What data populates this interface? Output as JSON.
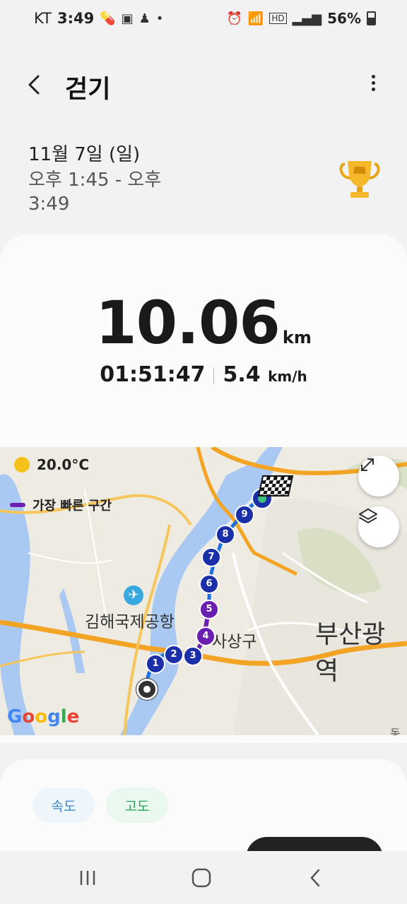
{
  "status_bar": {
    "carrier": "KT",
    "time": "3:49",
    "battery": "56%",
    "left_icons": [
      "pill-icon",
      "image-icon",
      "person-icon",
      "dot-icon"
    ],
    "right_icons": [
      "alarm-icon",
      "wifi-icon",
      "hd-icon",
      "signal-icon",
      "battery-icon"
    ]
  },
  "header": {
    "title": "걷기"
  },
  "summary": {
    "date": "11월 7일 (일)",
    "time_range": "오후 1:45 - 오후 3:49"
  },
  "stats": {
    "distance_value": "10.06",
    "distance_unit": "km",
    "duration": "01:51:47",
    "speed_value": "5.4",
    "speed_unit": "km/h"
  },
  "map": {
    "temperature": "20.0°C",
    "legend_label": "가장 빠른 구간",
    "labels": {
      "airport": "김해국제공항",
      "district": "사상구",
      "city": "부산광역",
      "partial": "동"
    },
    "markers": [
      "1",
      "2",
      "3",
      "4",
      "5",
      "6",
      "7",
      "8",
      "9"
    ],
    "google": "Google",
    "colors": {
      "route": "#1e6fe0",
      "fastest": "#6a1fb0",
      "marker_blue": "#1a2fa8",
      "water": "#a9c8f2",
      "road": "#f3a424"
    }
  },
  "tabs": {
    "speed": "속도",
    "altitude": "고도"
  }
}
